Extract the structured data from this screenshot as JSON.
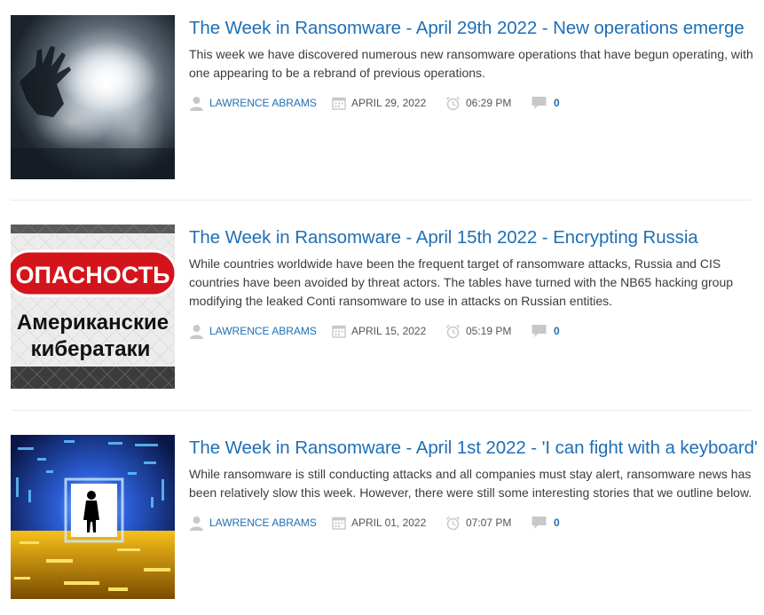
{
  "articles": [
    {
      "title": "The Week in Ransomware - April 29th 2022 - New operations emerge",
      "excerpt": "This week we have discovered numerous new ransomware operations that have begun operating, with one appearing to be a rebrand of previous operations.",
      "author": "LAWRENCE ABRAMS",
      "date": "APRIL 29, 2022",
      "time": "06:29 PM",
      "comments": "0"
    },
    {
      "title": "The Week in Ransomware - April 15th 2022 - Encrypting Russia",
      "excerpt": "While countries worldwide have been the frequent target of ransomware attacks, Russia and CIS countries have been avoided by threat actors. The tables have turned with the NB65 hacking group modifying the leaked Conti ransomware to use in attacks on Russian entities.",
      "author": "LAWRENCE ABRAMS",
      "date": "APRIL 15, 2022",
      "time": "05:19 PM",
      "comments": "0",
      "image_text": {
        "sign_top": "ОПАСНОСТЬ",
        "sign_line1": "Американские",
        "sign_line2": "кибератаки"
      }
    },
    {
      "title": "The Week in Ransomware - April 1st 2022 - 'I can fight with a keyboard'",
      "excerpt": "While ransomware is still conducting attacks and all companies must stay alert, ransomware news has been relatively slow this week. However, there were still some interesting stories that we outline below.",
      "author": "LAWRENCE ABRAMS",
      "date": "APRIL 01, 2022",
      "time": "07:07 PM",
      "comments": "0"
    }
  ],
  "colors": {
    "link": "#1f6fb5",
    "text": "#3c3c3c",
    "meta": "#555555",
    "icon": "#c8c8c8",
    "divider": "#ececec"
  }
}
